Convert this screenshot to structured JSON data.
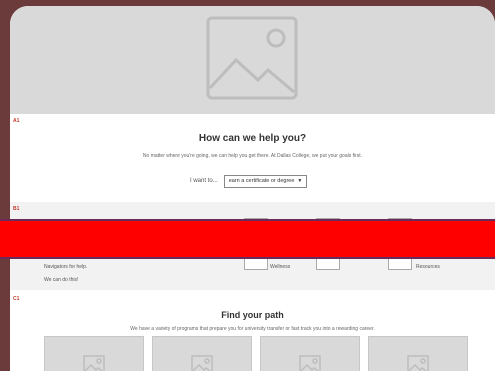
{
  "sections": {
    "a1_tag": "A1",
    "b1_tag": "B1",
    "c1_tag": "C1"
  },
  "help": {
    "title": "How can we help you?",
    "subtitle": "No matter where you're going, we can help you get there. At Dallas College, we put your goals first.",
    "want_label": "I want to...",
    "select_value": "earn a certificate or degree"
  },
  "band": {
    "text1": "Navigators for help.",
    "text2": "We can do this!",
    "icons": [
      {
        "label": "Wellness"
      },
      {
        "label": ""
      },
      {
        "label": "Resources"
      }
    ]
  },
  "path": {
    "title": "Find your path",
    "subtitle": "We have a variety of programs that prepare you for university transfer or fast track you into a rewarding career."
  },
  "colors": {
    "background": "#6b3a3a",
    "hero_placeholder": "#d9d9d9",
    "overlay_bar": "#ff0000",
    "section_tag": "#c0392b"
  },
  "icons": {
    "hero": "image-placeholder-icon",
    "dropdown": "caret-down-icon",
    "card": "image-placeholder-icon"
  }
}
